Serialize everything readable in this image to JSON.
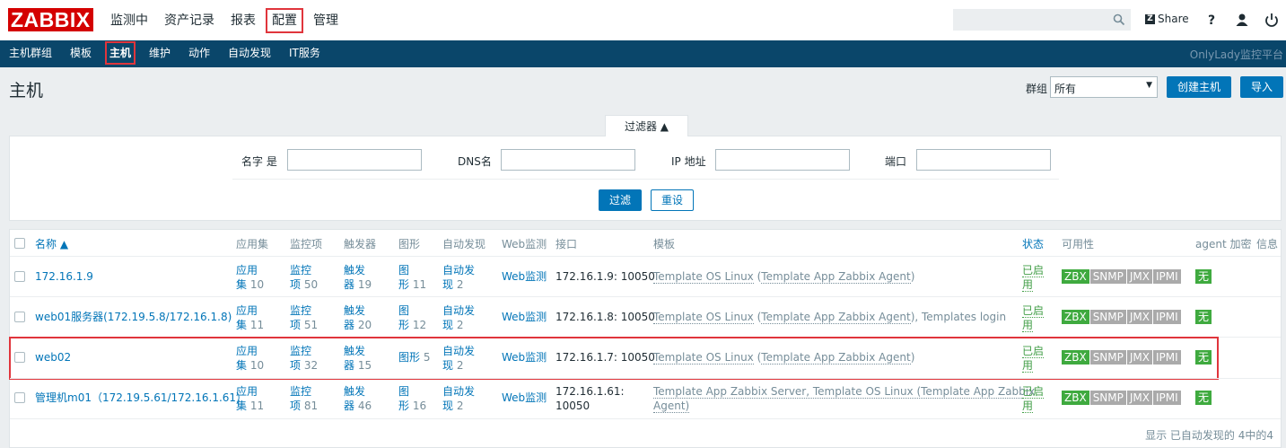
{
  "logo": "ZABBIX",
  "top_menu": [
    "监测中",
    "资产记录",
    "报表",
    "配置",
    "管理"
  ],
  "top_menu_active": "配置",
  "share_label": "Share",
  "nav": [
    "主机群组",
    "模板",
    "主机",
    "维护",
    "动作",
    "自动发现",
    "IT服务"
  ],
  "nav_active": "主机",
  "brand": "OnlyLady监控平台",
  "page_title": "主机",
  "group_label": "群组",
  "group_value": "所有",
  "create_host": "创建主机",
  "import": "导入",
  "filter": {
    "tab": "过滤器 ▲",
    "name_label": "名字 是",
    "dns_label": "DNS名",
    "ip_label": "IP 地址",
    "port_label": "端口",
    "apply": "过滤",
    "reset": "重设"
  },
  "columns": {
    "name": "名称 ▲",
    "apps": "应用集",
    "items": "监控项",
    "triggers": "触发器",
    "graphs": "图形",
    "discovery": "自动发现",
    "web": "Web监测",
    "interface": "接口",
    "templates": "模板",
    "status": "状态",
    "availability": "可用性",
    "encryption": "agent 加密",
    "info": "信息"
  },
  "rows": [
    {
      "name": "172.16.1.9",
      "apps_l1": "应用",
      "apps_l2": "集",
      "apps_n": "10",
      "items_l1": "监控",
      "items_l2": "项",
      "items_n": "50",
      "trig_l1": "触发",
      "trig_l2": "器",
      "trig_n": "19",
      "graph_l1": "图",
      "graph_l2": "形",
      "graph_n": "11",
      "disc_l1": "自动发",
      "disc_l2": "现",
      "disc_n": "2",
      "web": "Web监测",
      "iface": "172.16.1.9: 10050",
      "tpl_a": "Template OS Linux",
      "tpl_b": " (",
      "tpl_c": "Template App Zabbix Agent",
      "tpl_d": ")",
      "status_l1": "已启",
      "status_l2": "用"
    },
    {
      "name": "web01服务器(172.19.5.8/172.16.1.8)",
      "apps_l1": "应用",
      "apps_l2": "集",
      "apps_n": "11",
      "items_l1": "监控",
      "items_l2": "项",
      "items_n": "51",
      "trig_l1": "触发",
      "trig_l2": "器",
      "trig_n": "20",
      "graph_l1": "图",
      "graph_l2": "形",
      "graph_n": "12",
      "disc_l1": "自动发",
      "disc_l2": "现",
      "disc_n": "2",
      "web": "Web监测",
      "iface": "172.16.1.8: 10050",
      "tpl_a": "Template OS Linux",
      "tpl_b": " (",
      "tpl_c": "Template App Zabbix Agent",
      "tpl_d": "), Templates login",
      "status_l1": "已启",
      "status_l2": "用"
    },
    {
      "name": "web02",
      "apps_l1": "应用",
      "apps_l2": "集",
      "apps_n": "10",
      "items_l1": "监控",
      "items_l2": "项",
      "items_n": "32",
      "trig_l1": "触发",
      "trig_l2": "器",
      "trig_n": "15",
      "graph_single": "图形",
      "graph_n": "5",
      "disc_l1": "自动发",
      "disc_l2": "现",
      "disc_n": "2",
      "web": "Web监测",
      "iface": "172.16.1.7: 10050",
      "tpl_a": "Template OS Linux",
      "tpl_b": " (",
      "tpl_c": "Template App Zabbix Agent",
      "tpl_d": ")",
      "status_l1": "已启",
      "status_l2": "用"
    },
    {
      "name": "管理机m01（172.19.5.61/172.16.1.61）",
      "apps_l1": "应用",
      "apps_l2": "集",
      "apps_n": "11",
      "items_l1": "监控",
      "items_l2": "项",
      "items_n": "81",
      "trig_l1": "触发",
      "trig_l2": "器",
      "trig_n": "46",
      "graph_l1": "图",
      "graph_l2": "形",
      "graph_n": "16",
      "disc_l1": "自动发",
      "disc_l2": "现",
      "disc_n": "2",
      "web": "Web监测",
      "iface_l1": "172.16.1.61:",
      "iface_l2": "10050",
      "tpl_line1": "Template App Zabbix Server, Template OS Linux (Template App Zabbix",
      "tpl_line2": "Agent)",
      "status_l1": "已启",
      "status_l2": "用"
    }
  ],
  "availability": [
    "ZBX",
    "SNMP",
    "JMX",
    "IPMI"
  ],
  "encryption_value": "无",
  "footer": "显示 已自动发现的 4中的4",
  "colors": {
    "logo": "#d40000",
    "navbar": "#0a466a",
    "link": "#0275b8",
    "enabled": "#429e47",
    "highlight": "#e0353c"
  }
}
